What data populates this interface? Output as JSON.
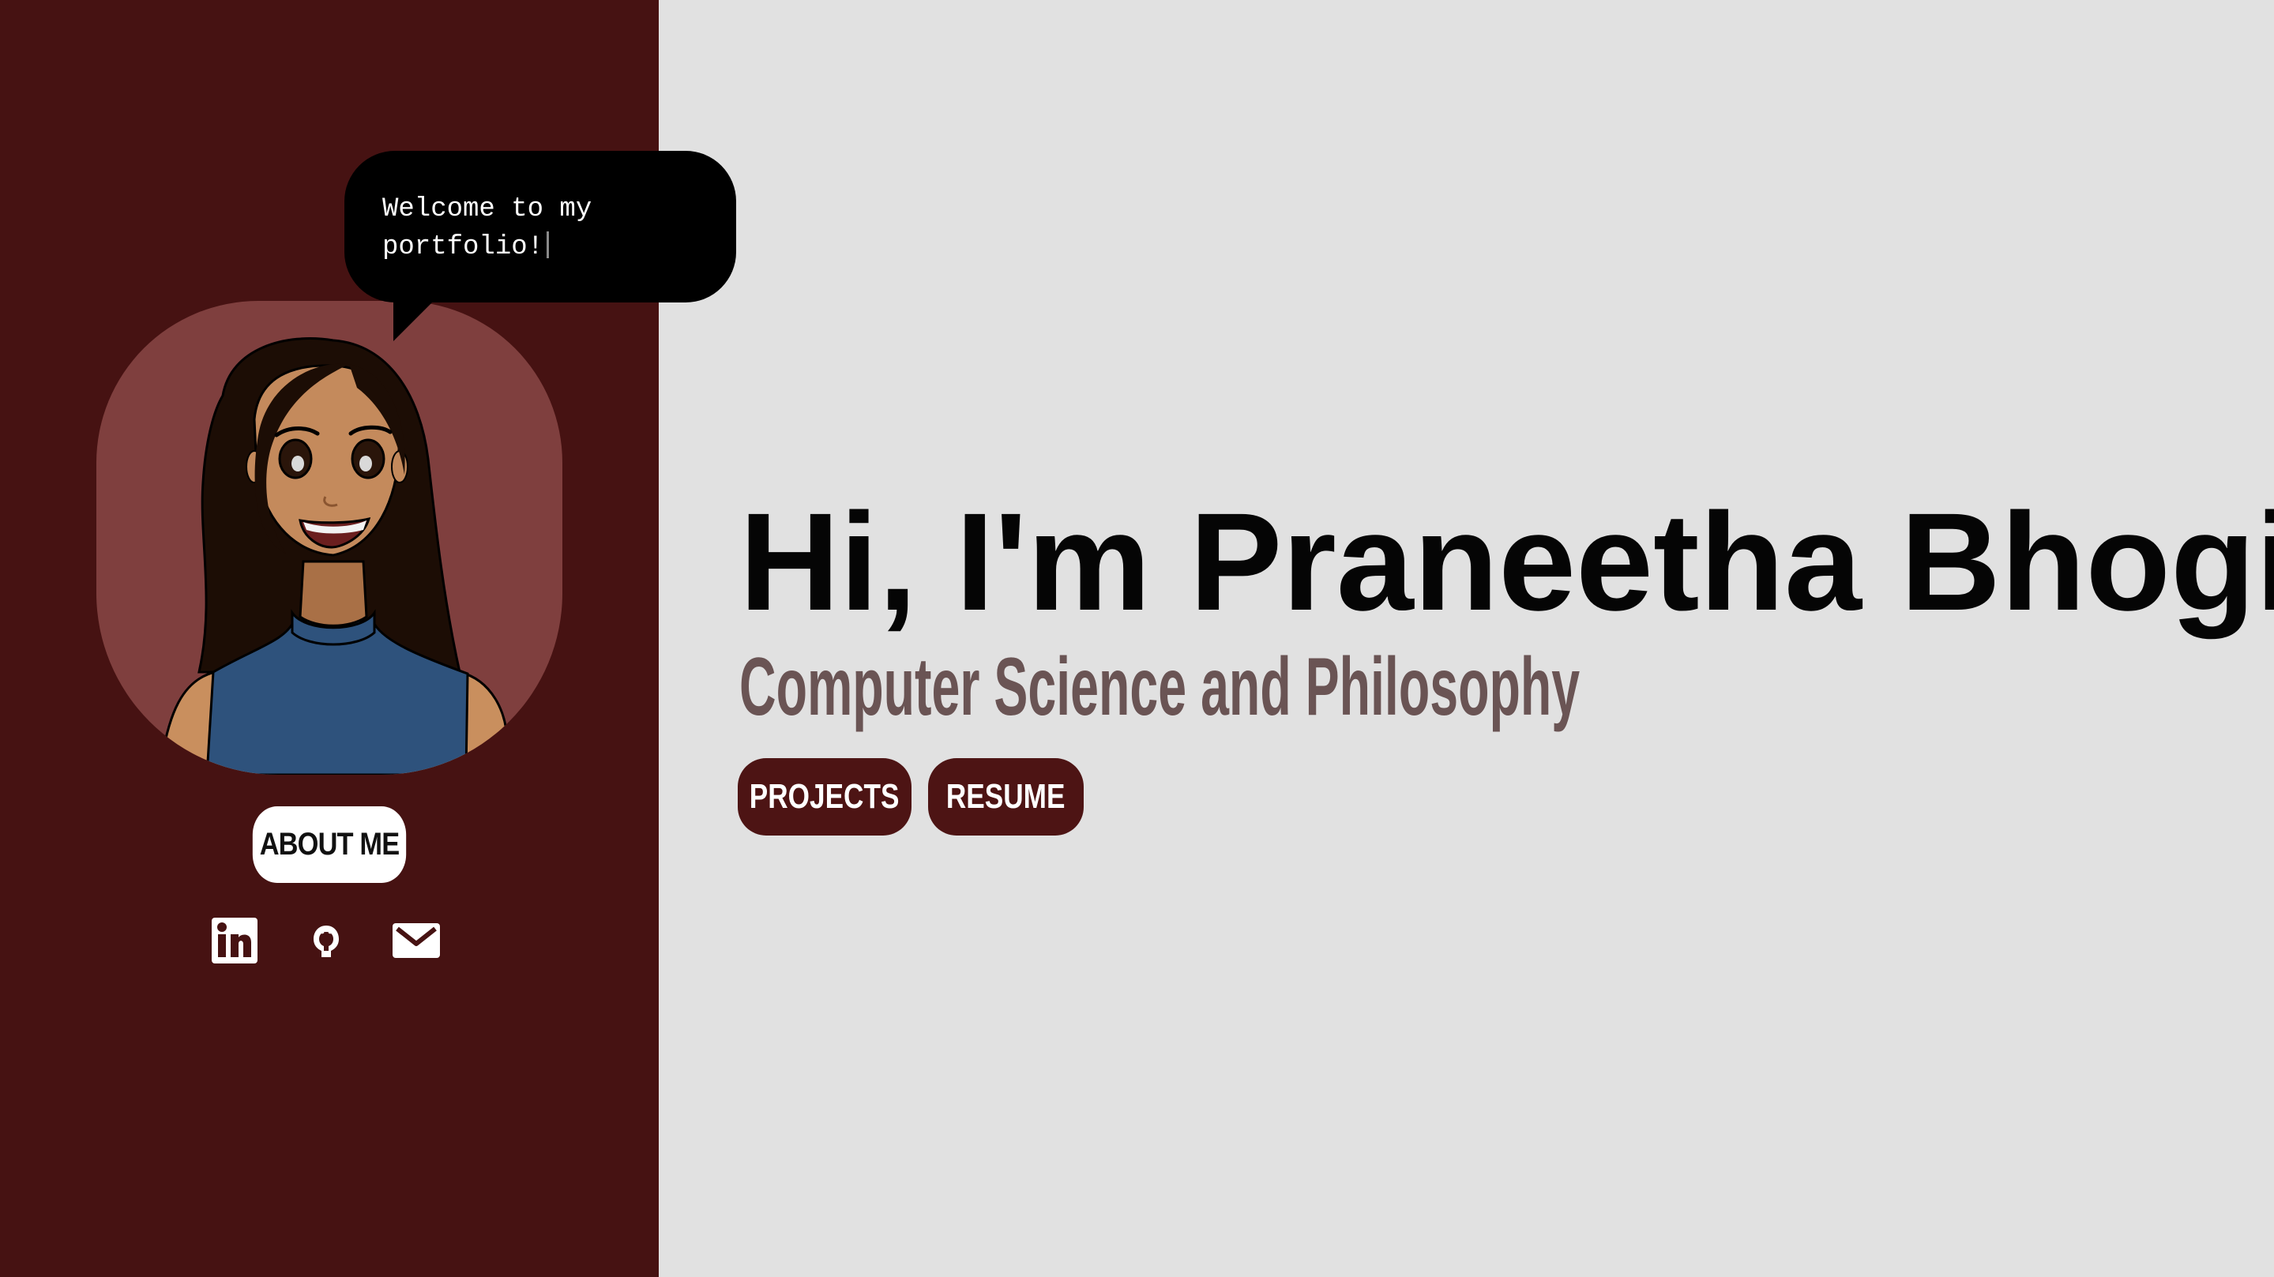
{
  "sidebar": {
    "background_color": "#461212",
    "greeting_bubble": {
      "text": "Welcome to my portfolio!"
    },
    "avatar": {
      "icon": "avatar-illustration"
    },
    "about_button": {
      "label": "ABOUT ME"
    },
    "social_links": [
      {
        "name": "linkedin",
        "icon": "linkedin-icon"
      },
      {
        "name": "github",
        "icon": "github-icon"
      },
      {
        "name": "email",
        "icon": "mail-icon"
      }
    ]
  },
  "main": {
    "background_color": "#e1e1e1",
    "heading": "Hi, I'm Praneetha Bhogi",
    "subheading": "Computer Science and Philosophy",
    "buttons": [
      {
        "label": "PROJECTS"
      },
      {
        "label": "RESUME"
      }
    ]
  },
  "colors": {
    "accent": "#4d1414",
    "subtitle": "#6a5454"
  }
}
